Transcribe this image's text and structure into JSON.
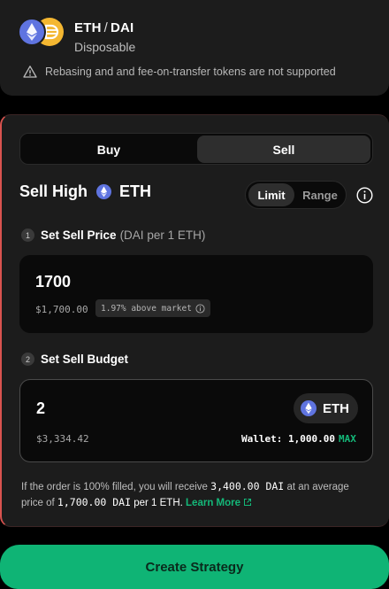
{
  "pair": {
    "base": "ETH",
    "separator": "/",
    "quote": "DAI",
    "strategy_type": "Disposable",
    "warning": "Rebasing and and fee-on-transfer tokens are not supported",
    "icons": [
      "eth-icon",
      "dai-icon"
    ]
  },
  "order": {
    "tabs": {
      "buy": "Buy",
      "sell": "Sell",
      "active": "Sell"
    },
    "heading": "Sell High",
    "heading_token": "ETH",
    "mode": {
      "limit": "Limit",
      "range": "Range",
      "active": "Limit"
    },
    "step1": {
      "number": "1",
      "label": "Set Sell Price",
      "unit": "(DAI per 1 ETH)"
    },
    "price": {
      "value": "1700",
      "usd": "$1,700.00",
      "market_badge": "1.97% above market"
    },
    "step2": {
      "number": "2",
      "label": "Set Sell Budget"
    },
    "budget": {
      "value": "2",
      "usd": "$3,334.42",
      "token": "ETH",
      "wallet_label": "Wallet: 1,000.00",
      "max_label": "MAX"
    },
    "summary": {
      "text1": "If the order is 100% filled, you will receive",
      "receive_amount": "3,400.00 DAI",
      "text2": "at an average price of",
      "avg_price": "1,700.00 DAI",
      "text3": "per 1 ETH.",
      "learn_more": "Learn More"
    }
  },
  "cta": {
    "label": "Create Strategy"
  },
  "colors": {
    "accent_green": "#0fb475",
    "sell_border": "#d9534f",
    "eth": "#5f74e0",
    "dai": "#f4b731"
  }
}
